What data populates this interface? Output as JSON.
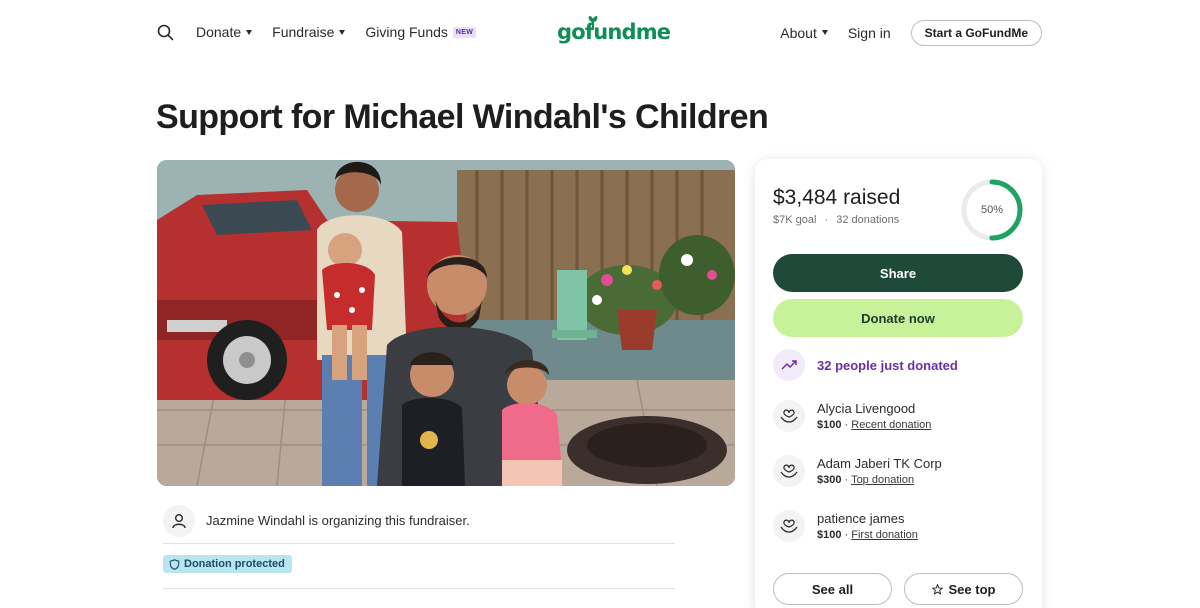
{
  "nav": {
    "donate": "Donate",
    "fundraise": "Fundraise",
    "giving_funds": "Giving Funds",
    "new_badge": "NEW",
    "logo": "gofundme",
    "about": "About",
    "sign_in": "Sign in",
    "start": "Start a GoFundMe"
  },
  "title": "Support for Michael Windahl's Children",
  "organizer": {
    "text": "Jazmine Windahl is organizing this fundraiser."
  },
  "protected_label": "Donation protected",
  "card": {
    "raised": "$3,484 raised",
    "goal": "$7K goal",
    "separator": "·",
    "donations": "32 donations",
    "progress_label": "50%",
    "progress_fraction": 0.5,
    "share": "Share",
    "donate": "Donate now",
    "recent": "32 people just donated",
    "donors": [
      {
        "name": "Alycia Livengood",
        "amount": "$100",
        "sep": " · ",
        "tag": "Recent donation"
      },
      {
        "name": "Adam Jaberi TK Corp",
        "amount": "$300",
        "sep": " · ",
        "tag": "Top donation"
      },
      {
        "name": "patience james",
        "amount": "$100",
        "sep": " · ",
        "tag": "First donation"
      }
    ],
    "see_all": "See all",
    "see_top": "See top"
  },
  "colors": {
    "brand_green": "#0d8f55",
    "share_bg": "#1f4a3a",
    "donate_bg": "#c8f29a",
    "progress": "#1fa363",
    "recent_purple": "#6b2fa8",
    "protected_bg": "#b9e5f0"
  }
}
